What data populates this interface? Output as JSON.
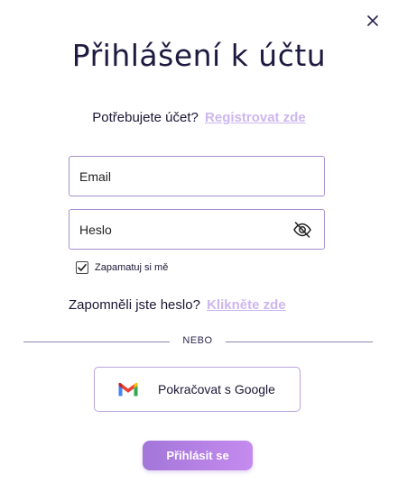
{
  "dialog": {
    "title": "Přihlášení k účtu",
    "close_icon": "close-icon"
  },
  "signup": {
    "prompt": "Potřebujete účet?",
    "link": "Registrovat zde"
  },
  "form": {
    "email_placeholder": "Email",
    "password_placeholder": "Heslo",
    "password_toggle_icon": "eye-slash-icon",
    "remember_label": "Zapamatuj si mě",
    "remember_checked": true
  },
  "forgot": {
    "prompt": "Zapomněli jste heslo?",
    "link": "Klikněte zde"
  },
  "divider": {
    "label": "NEBO"
  },
  "google": {
    "label": "Pokračovat s Google",
    "icon": "gmail-icon"
  },
  "submit": {
    "label": "Přihlásit se"
  },
  "colors": {
    "accent": "#b98be8",
    "link": "#cdb6f0",
    "text": "#1a1633",
    "border": "#a58fd0"
  }
}
